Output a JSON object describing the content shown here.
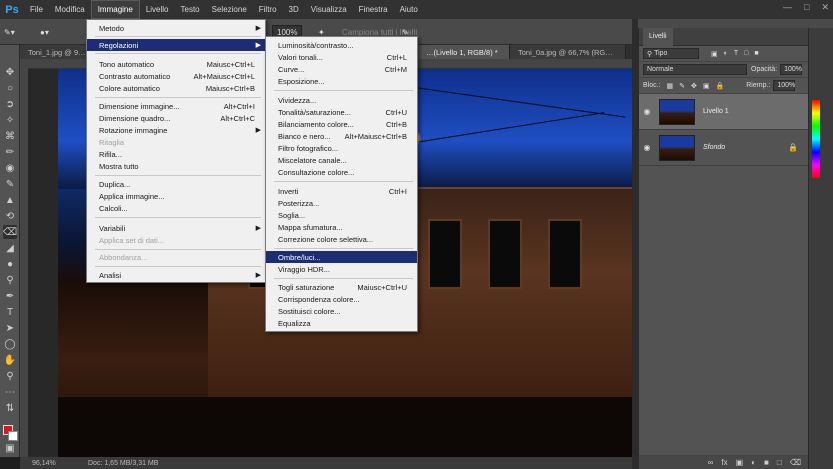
{
  "app": {
    "logo": "Ps"
  },
  "menubar": {
    "items": [
      "File",
      "Modifica",
      "Immagine",
      "Livello",
      "Testo",
      "Selezione",
      "Filtro",
      "3D",
      "Visualizza",
      "Finestra",
      "Aiuto"
    ],
    "active": "Immagine"
  },
  "options": {
    "zoom": "100%",
    "sample": "Campiona tutti i livelli"
  },
  "tabs": [
    {
      "label": "Toni_1.jpg @ 9…",
      "active": false
    },
    {
      "label": "…(Livello 1, RGB/8) *",
      "active": true
    },
    {
      "label": "Toni_0a.jpg @ 66,7% (RG…",
      "active": false
    }
  ],
  "status": {
    "zoom": "96,14%",
    "doc": "Doc: 1,65 MB/3,31 MB"
  },
  "menu_immagine": {
    "items": [
      {
        "label": "Metodo",
        "submenu": true
      },
      {
        "label": "Regolazioni",
        "submenu": true,
        "highlight": true
      },
      {
        "label": "Tono automatico",
        "shortcut": "Maiusc+Ctrl+L"
      },
      {
        "label": "Contrasto automatico",
        "shortcut": "Alt+Maiusc+Ctrl+L"
      },
      {
        "label": "Colore automatico",
        "shortcut": "Maiusc+Ctrl+B"
      },
      {
        "label": "Dimensione immagine...",
        "shortcut": "Alt+Ctrl+I"
      },
      {
        "label": "Dimensione quadro...",
        "shortcut": "Alt+Ctrl+C"
      },
      {
        "label": "Rotazione immagine",
        "submenu": true
      },
      {
        "label": "Ritaglia",
        "disabled": true
      },
      {
        "label": "Rifila..."
      },
      {
        "label": "Mostra tutto"
      },
      {
        "label": "Duplica..."
      },
      {
        "label": "Applica immagine..."
      },
      {
        "label": "Calcoli..."
      },
      {
        "label": "Variabili",
        "submenu": true
      },
      {
        "label": "Applica set di dati...",
        "disabled": true
      },
      {
        "label": "Abbondanza...",
        "disabled": true
      },
      {
        "label": "Analisi",
        "submenu": true
      }
    ]
  },
  "menu_regolazioni": {
    "items": [
      {
        "label": "Luminosità/contrasto..."
      },
      {
        "label": "Valori tonali...",
        "shortcut": "Ctrl+L"
      },
      {
        "label": "Curve...",
        "shortcut": "Ctrl+M"
      },
      {
        "label": "Esposizione..."
      },
      {
        "label": "Vividezza..."
      },
      {
        "label": "Tonalità/saturazione...",
        "shortcut": "Ctrl+U"
      },
      {
        "label": "Bilanciamento colore...",
        "shortcut": "Ctrl+B"
      },
      {
        "label": "Bianco e nero...",
        "shortcut": "Alt+Maiusc+Ctrl+B"
      },
      {
        "label": "Filtro fotografico..."
      },
      {
        "label": "Miscelatore canale..."
      },
      {
        "label": "Consultazione colore..."
      },
      {
        "label": "Inverti",
        "shortcut": "Ctrl+I"
      },
      {
        "label": "Posterizza..."
      },
      {
        "label": "Soglia..."
      },
      {
        "label": "Mappa sfumatura..."
      },
      {
        "label": "Correzione colore selettiva..."
      },
      {
        "label": "Ombre/luci...",
        "highlight": true
      },
      {
        "label": "Viraggio HDR..."
      },
      {
        "label": "Togli saturazione",
        "shortcut": "Maiusc+Ctrl+U"
      },
      {
        "label": "Corrispondenza colore..."
      },
      {
        "label": "Sostituisci colore..."
      },
      {
        "label": "Equalizza"
      }
    ]
  },
  "layers": {
    "panel_title": "Livelli",
    "search": "Tipo",
    "blend_mode": "Normale",
    "opacity_label": "Opacità:",
    "opacity": "100%",
    "lock_label": "Bloc.:",
    "fill_label": "Riemp.:",
    "fill": "100%",
    "items": [
      {
        "name": "Livello 1",
        "selected": true,
        "locked": false
      },
      {
        "name": "Sfondo",
        "selected": false,
        "locked": true
      }
    ]
  },
  "colors": {
    "accent": "#1d2c74",
    "foreground": "#d21b1b",
    "background": "#ffffff"
  }
}
